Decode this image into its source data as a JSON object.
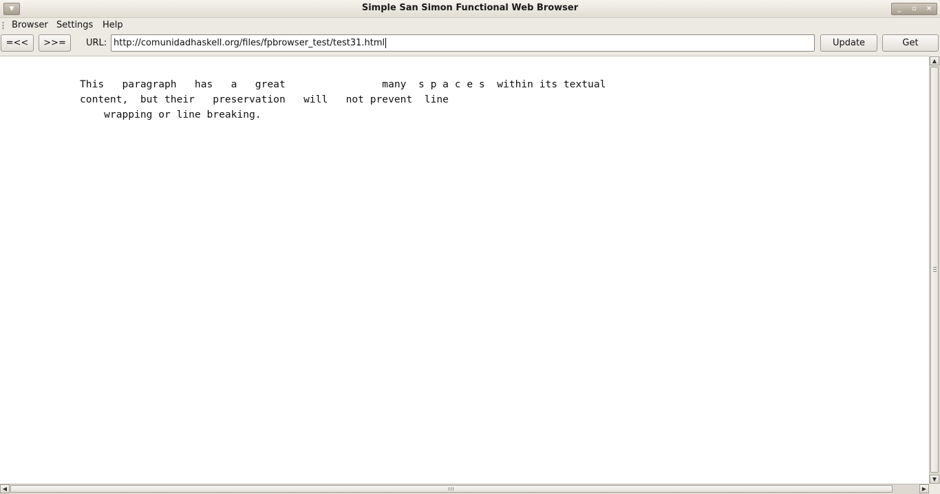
{
  "window": {
    "title": "Simple San Simon Functional Web Browser",
    "controls": {
      "minimize": "_",
      "maximize": "▫",
      "close": "×"
    }
  },
  "menubar": {
    "items": [
      "Browser",
      "Settings",
      "Help"
    ]
  },
  "toolbar": {
    "back_label": "=<<",
    "forward_label": ">>=",
    "url_label": "URL:",
    "url_value": "http://comunidadhaskell.org/files/fpbrowser_test/test31.html",
    "update_label": "Update",
    "get_label": "Get"
  },
  "content": {
    "lines": [
      "This   paragraph   has   a   great                many  s p a c e s  within its textual",
      "content,  but their   preservation   will   not prevent  line",
      "    wrapping or line breaking."
    ]
  },
  "icons": {
    "window_menu": "chevron-down-icon",
    "scroll_up": "arrow-up-icon",
    "scroll_down": "arrow-down-icon",
    "scroll_left": "arrow-left-icon",
    "scroll_right": "arrow-right-icon"
  }
}
